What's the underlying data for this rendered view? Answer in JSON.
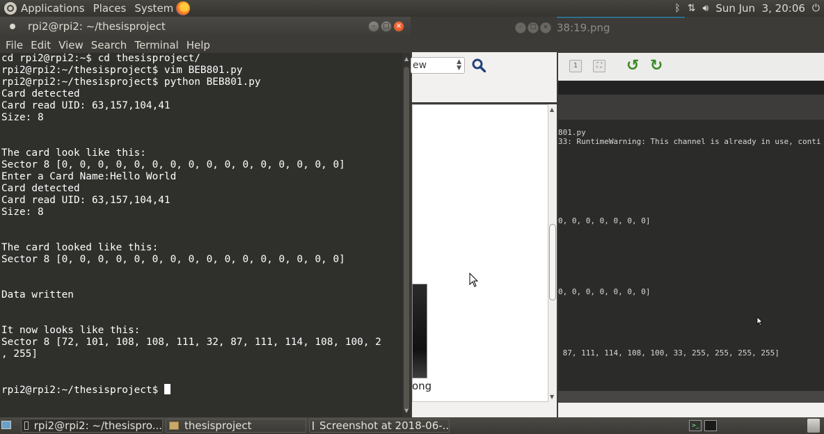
{
  "top_panel": {
    "menus": [
      "Applications",
      "Places",
      "System"
    ],
    "datetime": "Sun Jun  3, 20:06"
  },
  "terminal": {
    "title": "rpi2@rpi2: ~/thesisproject",
    "menu": [
      "File",
      "Edit",
      "View",
      "Search",
      "Terminal",
      "Help"
    ],
    "lines": [
      "cd rpi2@rpi2:~$ cd thesisproject/",
      "rpi2@rpi2:~/thesisproject$ vim BEB801.py",
      "rpi2@rpi2:~/thesisproject$ python BEB801.py",
      "Card detected",
      "Card read UID: 63,157,104,41",
      "Size: 8",
      "",
      "",
      "The card look like this:",
      "Sector 8 [0, 0, 0, 0, 0, 0, 0, 0, 0, 0, 0, 0, 0, 0, 0, 0]",
      "Enter a Card Name:Hello World",
      "Card detected",
      "Card read UID: 63,157,104,41",
      "Size: 8",
      "",
      "",
      "The card looked like this:",
      "Sector 8 [0, 0, 0, 0, 0, 0, 0, 0, 0, 0, 0, 0, 0, 0, 0, 0]",
      "",
      "",
      "Data written",
      "",
      "",
      "It now looks like this:",
      "Sector 8 [72, 101, 108, 108, 111, 32, 87, 111, 114, 108, 100, 2",
      ", 255]",
      "",
      "",
      "rpi2@rpi2:~/thesisproject$ "
    ]
  },
  "file_browser": {
    "view_select": "ew",
    "thumb_label": "ong"
  },
  "image_viewer": {
    "title": "38:19.png",
    "lines": [
      "801.py",
      "33: RuntimeWarning: This channel is already in use, conti",
      "0, 0, 0, 0, 0, 0, 0]",
      "0, 0, 0, 0, 0, 0, 0]",
      " 87, 111, 114, 108, 100, 33, 255, 255, 255, 255]"
    ]
  },
  "taskbar": {
    "tasks": [
      "rpi2@rpi2: ~/thesispro...",
      "thesisproject",
      "Screenshot at 2018-06-..."
    ]
  }
}
